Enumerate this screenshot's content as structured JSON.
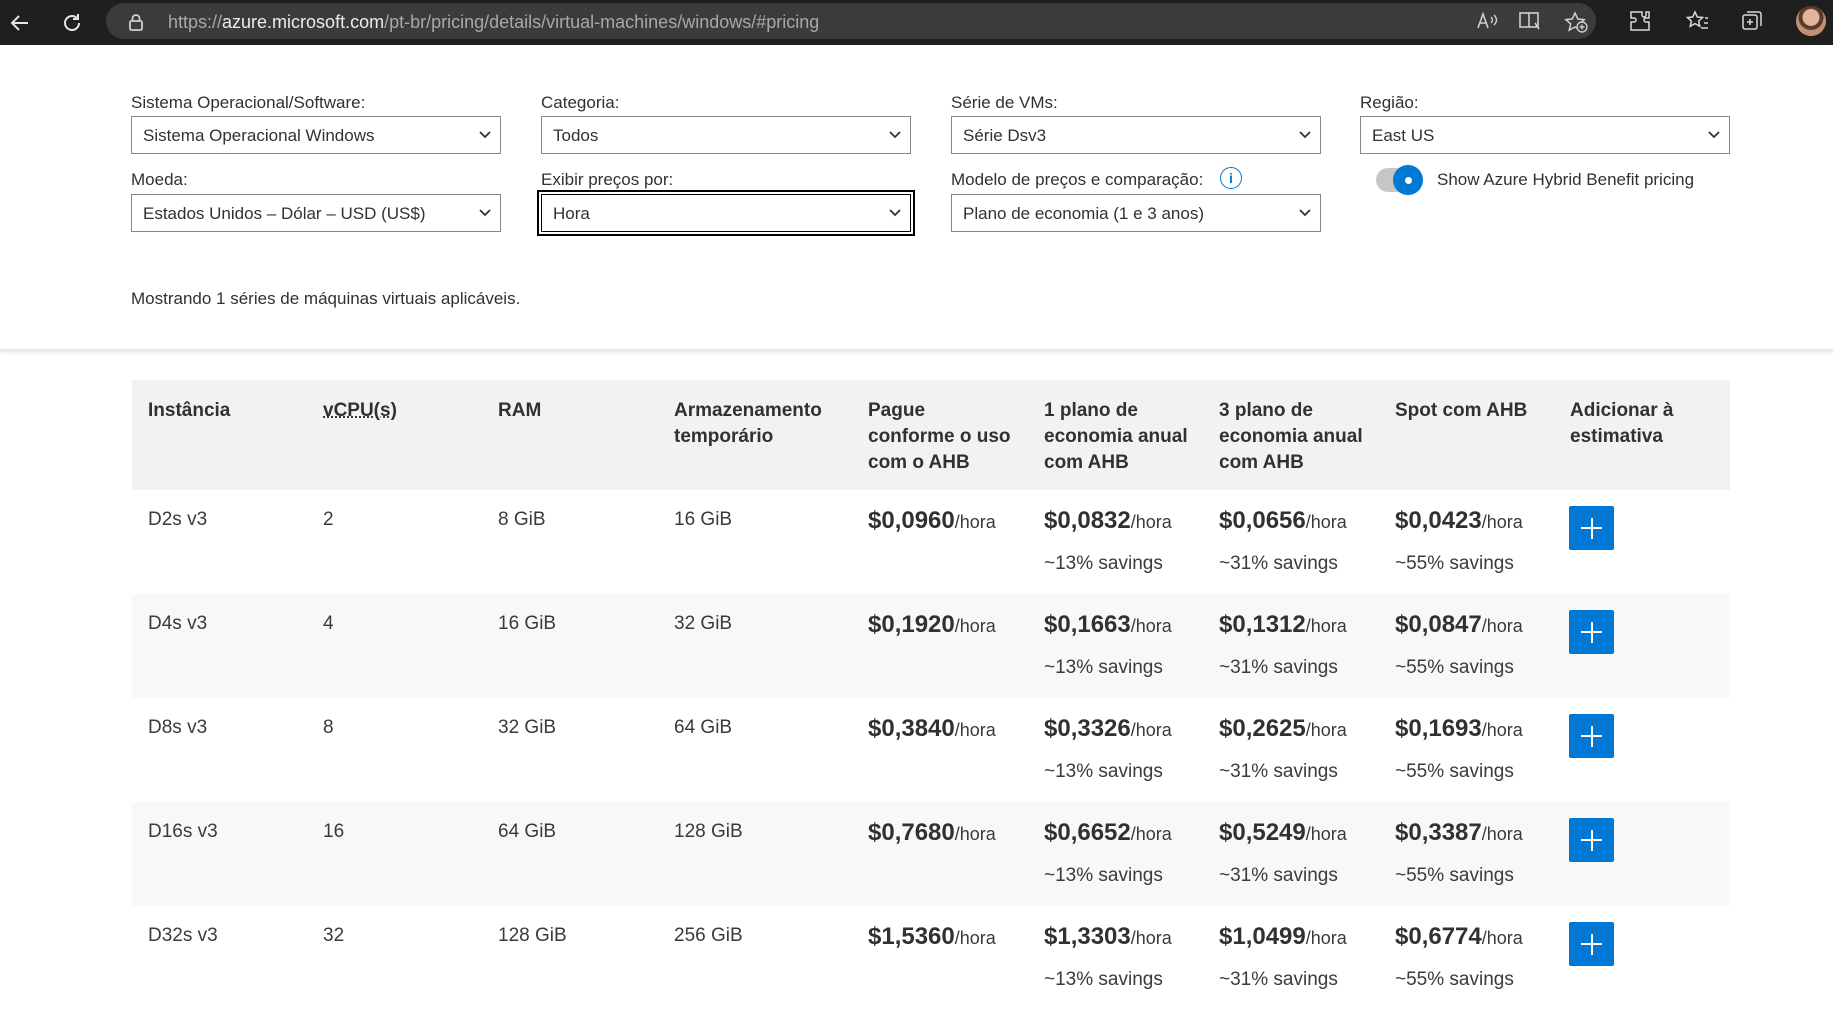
{
  "browser": {
    "url_prefix": "https://",
    "url_host": "azure.microsoft.com",
    "url_path": "/pt-br/pricing/details/virtual-machines/windows/#pricing"
  },
  "filters": {
    "os": {
      "label": "Sistema Operacional/Software:",
      "value": "Sistema Operacional Windows"
    },
    "category": {
      "label": "Categoria:",
      "value": "Todos"
    },
    "series": {
      "label": "Série de VMs:",
      "value": "Série Dsv3"
    },
    "region": {
      "label": "Região:",
      "value": "East US"
    },
    "currency": {
      "label": "Moeda:",
      "value": "Estados Unidos – Dólar – USD (US$)"
    },
    "display": {
      "label": "Exibir preços por:",
      "value": "Hora"
    },
    "pricing_model": {
      "label": "Modelo de preços e comparação:",
      "value": "Plano de economia (1 e 3 anos)"
    },
    "hybrid_toggle": {
      "label": "Show Azure Hybrid Benefit pricing",
      "on": true
    }
  },
  "count_text": "Mostrando 1 séries de máquinas virtuais aplicáveis.",
  "table": {
    "headers": {
      "instance": "Instância",
      "vcpu": "vCPU(s)",
      "ram": "RAM",
      "storage": [
        "Armazenamento",
        "temporário"
      ],
      "payg": [
        "Pague",
        "conforme o uso",
        "com o AHB"
      ],
      "plan1": [
        "1 plano de",
        "economia anual",
        "com AHB"
      ],
      "plan3": [
        "3 plano de",
        "economia anual",
        "com AHB"
      ],
      "spot": "Spot com AHB",
      "add": [
        "Adicionar à",
        "estimativa"
      ]
    },
    "unit": "/hora",
    "rows": [
      {
        "instance": "D2s v3",
        "vcpu": "2",
        "ram": "8 GiB",
        "storage": "16 GiB",
        "payg": "$0,0960",
        "plan1": "$0,0832",
        "plan1_sav": "~13% savings",
        "plan3": "$0,0656",
        "plan3_sav": "~31% savings",
        "spot": "$0,0423",
        "spot_sav": "~55% savings"
      },
      {
        "instance": "D4s v3",
        "vcpu": "4",
        "ram": "16 GiB",
        "storage": "32 GiB",
        "payg": "$0,1920",
        "plan1": "$0,1663",
        "plan1_sav": "~13% savings",
        "plan3": "$0,1312",
        "plan3_sav": "~31% savings",
        "spot": "$0,0847",
        "spot_sav": "~55% savings"
      },
      {
        "instance": "D8s v3",
        "vcpu": "8",
        "ram": "32 GiB",
        "storage": "64 GiB",
        "payg": "$0,3840",
        "plan1": "$0,3326",
        "plan1_sav": "~13% savings",
        "plan3": "$0,2625",
        "plan3_sav": "~31% savings",
        "spot": "$0,1693",
        "spot_sav": "~55% savings"
      },
      {
        "instance": "D16s v3",
        "vcpu": "16",
        "ram": "64 GiB",
        "storage": "128 GiB",
        "payg": "$0,7680",
        "plan1": "$0,6652",
        "plan1_sav": "~13% savings",
        "plan3": "$0,5249",
        "plan3_sav": "~31% savings",
        "spot": "$0,3387",
        "spot_sav": "~55% savings"
      },
      {
        "instance": "D32s v3",
        "vcpu": "32",
        "ram": "128 GiB",
        "storage": "256 GiB",
        "payg": "$1,5360",
        "plan1": "$1,3303",
        "plan1_sav": "~13% savings",
        "plan3": "$1,0499",
        "plan3_sav": "~31% savings",
        "spot": "$0,6774",
        "spot_sav": "~55% savings"
      }
    ]
  },
  "colors": {
    "accent": "#0078d4",
    "chrome": "#1f1f1f",
    "header_bg": "#f2f2f2"
  }
}
